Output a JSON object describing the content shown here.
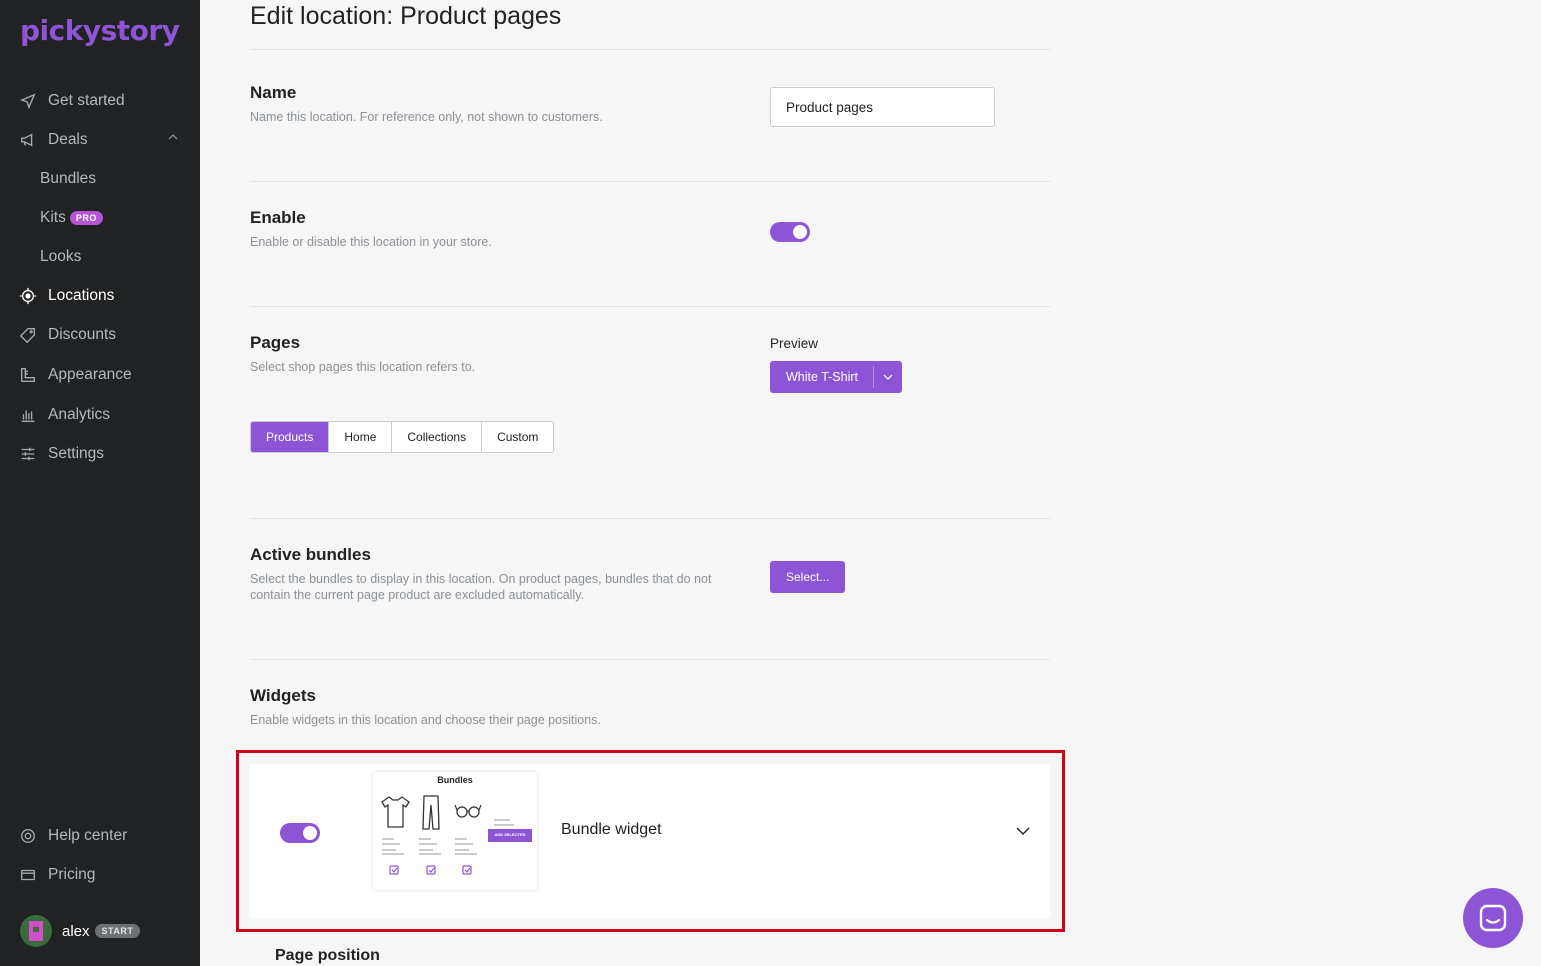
{
  "sidebar": {
    "logo": "pickystory",
    "nav": {
      "get_started": "Get started",
      "deals": "Deals",
      "bundles": "Bundles",
      "kits": "Kits",
      "kits_badge": "PRO",
      "looks": "Looks",
      "locations": "Locations",
      "discounts": "Discounts",
      "appearance": "Appearance",
      "analytics": "Analytics",
      "settings": "Settings",
      "help_center": "Help center",
      "pricing": "Pricing"
    },
    "user": {
      "name": "alex",
      "plan_badge": "START"
    }
  },
  "page": {
    "title": "Edit location: Product pages"
  },
  "name_section": {
    "title": "Name",
    "description": "Name this location. For reference only, not shown to customers.",
    "value": "Product pages"
  },
  "enable_section": {
    "title": "Enable",
    "description": "Enable or disable this location in your store.",
    "enabled": true
  },
  "pages_section": {
    "title": "Pages",
    "description": "Select shop pages this location refers to.",
    "preview_label": "Preview",
    "preview_value": "White T-Shirt",
    "tabs": [
      "Products",
      "Home",
      "Collections",
      "Custom"
    ],
    "selected_tab": "Products"
  },
  "bundles_section": {
    "title": "Active bundles",
    "description": "Select the bundles to display in this location. On product pages, bundles that do not contain the current page product are excluded automatically.",
    "select_label": "Select..."
  },
  "widgets_section": {
    "title": "Widgets",
    "description": "Enable widgets in this location and choose their page positions.",
    "widget": {
      "name": "Bundle widget",
      "enabled": true,
      "thumbnail_title": "Bundles",
      "thumbnail_button": "ADD SELECTED"
    },
    "page_position_title": "Page position"
  },
  "colors": {
    "accent": "#8e54d6",
    "sidebar_bg": "#202223",
    "highlight": "#d0021b"
  }
}
